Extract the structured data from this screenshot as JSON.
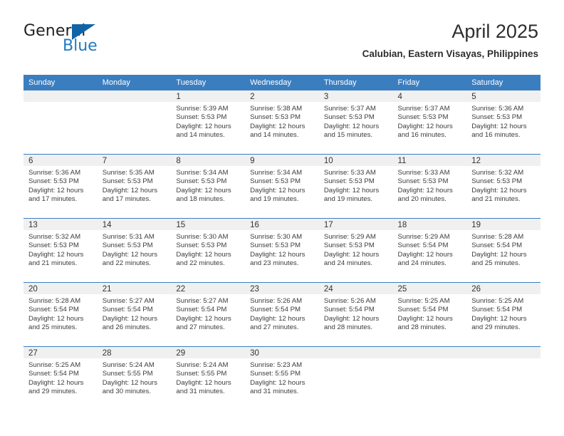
{
  "brand": {
    "name_part1": "General",
    "name_part2": "Blue"
  },
  "header": {
    "month_title": "April 2025",
    "location": "Calubian, Eastern Visayas, Philippines"
  },
  "colors": {
    "header_blue": "#3b7ec0",
    "brand_blue": "#1f7bc1",
    "daynum_band": "#f0f0f0",
    "text": "#3c3c3c"
  },
  "calendar": {
    "weekday_headers": [
      "Sunday",
      "Monday",
      "Tuesday",
      "Wednesday",
      "Thursday",
      "Friday",
      "Saturday"
    ],
    "weeks": [
      [
        {
          "day": "",
          "blank": true,
          "sunrise": "",
          "sunset": "",
          "daylight_1": "",
          "daylight_2": ""
        },
        {
          "day": "",
          "blank": true,
          "sunrise": "",
          "sunset": "",
          "daylight_1": "",
          "daylight_2": ""
        },
        {
          "day": "1",
          "blank": false,
          "sunrise": "Sunrise: 5:39 AM",
          "sunset": "Sunset: 5:53 PM",
          "daylight_1": "Daylight: 12 hours",
          "daylight_2": "and 14 minutes."
        },
        {
          "day": "2",
          "blank": false,
          "sunrise": "Sunrise: 5:38 AM",
          "sunset": "Sunset: 5:53 PM",
          "daylight_1": "Daylight: 12 hours",
          "daylight_2": "and 14 minutes."
        },
        {
          "day": "3",
          "blank": false,
          "sunrise": "Sunrise: 5:37 AM",
          "sunset": "Sunset: 5:53 PM",
          "daylight_1": "Daylight: 12 hours",
          "daylight_2": "and 15 minutes."
        },
        {
          "day": "4",
          "blank": false,
          "sunrise": "Sunrise: 5:37 AM",
          "sunset": "Sunset: 5:53 PM",
          "daylight_1": "Daylight: 12 hours",
          "daylight_2": "and 16 minutes."
        },
        {
          "day": "5",
          "blank": false,
          "sunrise": "Sunrise: 5:36 AM",
          "sunset": "Sunset: 5:53 PM",
          "daylight_1": "Daylight: 12 hours",
          "daylight_2": "and 16 minutes."
        }
      ],
      [
        {
          "day": "6",
          "blank": false,
          "sunrise": "Sunrise: 5:36 AM",
          "sunset": "Sunset: 5:53 PM",
          "daylight_1": "Daylight: 12 hours",
          "daylight_2": "and 17 minutes."
        },
        {
          "day": "7",
          "blank": false,
          "sunrise": "Sunrise: 5:35 AM",
          "sunset": "Sunset: 5:53 PM",
          "daylight_1": "Daylight: 12 hours",
          "daylight_2": "and 17 minutes."
        },
        {
          "day": "8",
          "blank": false,
          "sunrise": "Sunrise: 5:34 AM",
          "sunset": "Sunset: 5:53 PM",
          "daylight_1": "Daylight: 12 hours",
          "daylight_2": "and 18 minutes."
        },
        {
          "day": "9",
          "blank": false,
          "sunrise": "Sunrise: 5:34 AM",
          "sunset": "Sunset: 5:53 PM",
          "daylight_1": "Daylight: 12 hours",
          "daylight_2": "and 19 minutes."
        },
        {
          "day": "10",
          "blank": false,
          "sunrise": "Sunrise: 5:33 AM",
          "sunset": "Sunset: 5:53 PM",
          "daylight_1": "Daylight: 12 hours",
          "daylight_2": "and 19 minutes."
        },
        {
          "day": "11",
          "blank": false,
          "sunrise": "Sunrise: 5:33 AM",
          "sunset": "Sunset: 5:53 PM",
          "daylight_1": "Daylight: 12 hours",
          "daylight_2": "and 20 minutes."
        },
        {
          "day": "12",
          "blank": false,
          "sunrise": "Sunrise: 5:32 AM",
          "sunset": "Sunset: 5:53 PM",
          "daylight_1": "Daylight: 12 hours",
          "daylight_2": "and 21 minutes."
        }
      ],
      [
        {
          "day": "13",
          "blank": false,
          "sunrise": "Sunrise: 5:32 AM",
          "sunset": "Sunset: 5:53 PM",
          "daylight_1": "Daylight: 12 hours",
          "daylight_2": "and 21 minutes."
        },
        {
          "day": "14",
          "blank": false,
          "sunrise": "Sunrise: 5:31 AM",
          "sunset": "Sunset: 5:53 PM",
          "daylight_1": "Daylight: 12 hours",
          "daylight_2": "and 22 minutes."
        },
        {
          "day": "15",
          "blank": false,
          "sunrise": "Sunrise: 5:30 AM",
          "sunset": "Sunset: 5:53 PM",
          "daylight_1": "Daylight: 12 hours",
          "daylight_2": "and 22 minutes."
        },
        {
          "day": "16",
          "blank": false,
          "sunrise": "Sunrise: 5:30 AM",
          "sunset": "Sunset: 5:53 PM",
          "daylight_1": "Daylight: 12 hours",
          "daylight_2": "and 23 minutes."
        },
        {
          "day": "17",
          "blank": false,
          "sunrise": "Sunrise: 5:29 AM",
          "sunset": "Sunset: 5:53 PM",
          "daylight_1": "Daylight: 12 hours",
          "daylight_2": "and 24 minutes."
        },
        {
          "day": "18",
          "blank": false,
          "sunrise": "Sunrise: 5:29 AM",
          "sunset": "Sunset: 5:54 PM",
          "daylight_1": "Daylight: 12 hours",
          "daylight_2": "and 24 minutes."
        },
        {
          "day": "19",
          "blank": false,
          "sunrise": "Sunrise: 5:28 AM",
          "sunset": "Sunset: 5:54 PM",
          "daylight_1": "Daylight: 12 hours",
          "daylight_2": "and 25 minutes."
        }
      ],
      [
        {
          "day": "20",
          "blank": false,
          "sunrise": "Sunrise: 5:28 AM",
          "sunset": "Sunset: 5:54 PM",
          "daylight_1": "Daylight: 12 hours",
          "daylight_2": "and 25 minutes."
        },
        {
          "day": "21",
          "blank": false,
          "sunrise": "Sunrise: 5:27 AM",
          "sunset": "Sunset: 5:54 PM",
          "daylight_1": "Daylight: 12 hours",
          "daylight_2": "and 26 minutes."
        },
        {
          "day": "22",
          "blank": false,
          "sunrise": "Sunrise: 5:27 AM",
          "sunset": "Sunset: 5:54 PM",
          "daylight_1": "Daylight: 12 hours",
          "daylight_2": "and 27 minutes."
        },
        {
          "day": "23",
          "blank": false,
          "sunrise": "Sunrise: 5:26 AM",
          "sunset": "Sunset: 5:54 PM",
          "daylight_1": "Daylight: 12 hours",
          "daylight_2": "and 27 minutes."
        },
        {
          "day": "24",
          "blank": false,
          "sunrise": "Sunrise: 5:26 AM",
          "sunset": "Sunset: 5:54 PM",
          "daylight_1": "Daylight: 12 hours",
          "daylight_2": "and 28 minutes."
        },
        {
          "day": "25",
          "blank": false,
          "sunrise": "Sunrise: 5:25 AM",
          "sunset": "Sunset: 5:54 PM",
          "daylight_1": "Daylight: 12 hours",
          "daylight_2": "and 28 minutes."
        },
        {
          "day": "26",
          "blank": false,
          "sunrise": "Sunrise: 5:25 AM",
          "sunset": "Sunset: 5:54 PM",
          "daylight_1": "Daylight: 12 hours",
          "daylight_2": "and 29 minutes."
        }
      ],
      [
        {
          "day": "27",
          "blank": false,
          "sunrise": "Sunrise: 5:25 AM",
          "sunset": "Sunset: 5:54 PM",
          "daylight_1": "Daylight: 12 hours",
          "daylight_2": "and 29 minutes."
        },
        {
          "day": "28",
          "blank": false,
          "sunrise": "Sunrise: 5:24 AM",
          "sunset": "Sunset: 5:55 PM",
          "daylight_1": "Daylight: 12 hours",
          "daylight_2": "and 30 minutes."
        },
        {
          "day": "29",
          "blank": false,
          "sunrise": "Sunrise: 5:24 AM",
          "sunset": "Sunset: 5:55 PM",
          "daylight_1": "Daylight: 12 hours",
          "daylight_2": "and 31 minutes."
        },
        {
          "day": "30",
          "blank": false,
          "sunrise": "Sunrise: 5:23 AM",
          "sunset": "Sunset: 5:55 PM",
          "daylight_1": "Daylight: 12 hours",
          "daylight_2": "and 31 minutes."
        },
        {
          "day": "",
          "blank": true,
          "sunrise": "",
          "sunset": "",
          "daylight_1": "",
          "daylight_2": ""
        },
        {
          "day": "",
          "blank": true,
          "sunrise": "",
          "sunset": "",
          "daylight_1": "",
          "daylight_2": ""
        },
        {
          "day": "",
          "blank": true,
          "sunrise": "",
          "sunset": "",
          "daylight_1": "",
          "daylight_2": ""
        }
      ]
    ]
  }
}
